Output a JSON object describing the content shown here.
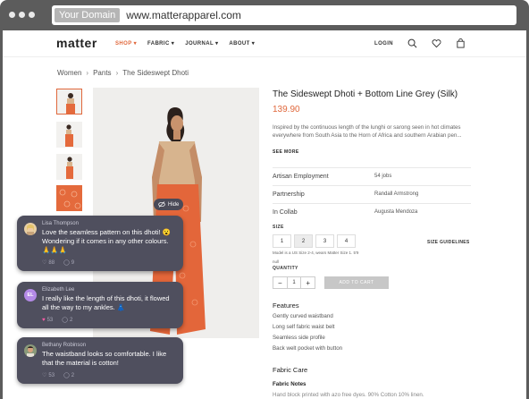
{
  "browser": {
    "domain_chip": "Your Domain",
    "url": "www.matterapparel.com"
  },
  "nav": {
    "logo": "matter",
    "menu": [
      "SHOP",
      "FABRIC",
      "JOURNAL",
      "ABOUT"
    ],
    "login": "LOGIN",
    "accent": "#e0683c"
  },
  "breadcrumb": [
    "Women",
    "Pants",
    "The Sideswept Dhoti"
  ],
  "gallery": {
    "hide_label": "Hide"
  },
  "product": {
    "title": "The Sideswept Dhoti + Bottom Line Grey (Silk)",
    "price": "139.90",
    "description": "Inspired by the continuous length of the lunghi or sarong seen in hot climates everywhere from South Asia to the Horn of Africa and southern Arabian pen...",
    "see_more": "SEE MORE",
    "attributes": [
      {
        "key": "Artisan Employment",
        "value": "54 jobs"
      },
      {
        "key": "Partnership",
        "value": "Randall Armstrong"
      },
      {
        "key": "In Collab",
        "value": "Augusta Mendoza"
      }
    ],
    "size_label": "SIZE",
    "sizes": [
      "1",
      "2",
      "3",
      "4"
    ],
    "selected_size": "2",
    "size_guidelines": "SIZE GUIDELINES",
    "model_note": "Model is a US Size 2-4, wears Matter Size 1. 5'9",
    "stock_note": "null",
    "quantity_label": "QUANTITY",
    "quantity": "1",
    "add_to_cart": "ADD TO CART",
    "features_heading": "Features",
    "features": [
      "Gently curved waistband",
      "Long self fabric waist belt",
      "Seamless side profile",
      "Back welt pocket with button"
    ],
    "care_heading": "Fabric Care",
    "notes_heading": "Fabric Notes",
    "notes_text": "Hand block printed with azo free dyes. 90% Cotton 10% linen."
  },
  "comments": [
    {
      "name": "Lisa Thompson",
      "text": "Love the seamless pattern on this dhoti! 😮 Wondering if it comes in any other colours. 🙏🙏🙏",
      "likes": "88",
      "replies": "9",
      "avatar": "blonde-woman-avatar"
    },
    {
      "name": "Elizabeth Lee",
      "text": "I really like the length of this dhoti, it flowed all the way to my ankles. 👗",
      "likes": "53",
      "replies": "2",
      "avatar": "initials-avatar",
      "initials": "EL",
      "liked": true
    },
    {
      "name": "Bethany Robinson",
      "text": "The waistband looks so comfortable. I like that the material is cotton!",
      "likes": "53",
      "replies": "2",
      "avatar": "dark-hair-woman-avatar"
    }
  ]
}
